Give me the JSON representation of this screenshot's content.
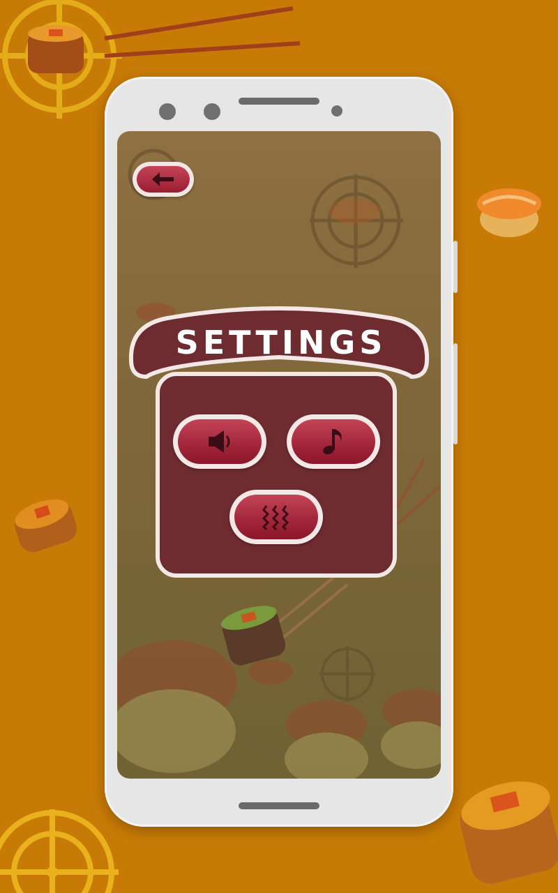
{
  "screen": {
    "title": "SETTINGS"
  },
  "controls": {
    "back": {
      "icon": "arrow-left-icon"
    },
    "sound": {
      "icon": "speaker-icon"
    },
    "music": {
      "icon": "music-note-icon"
    },
    "vibration": {
      "icon": "vibration-icon"
    }
  },
  "colors": {
    "background": "#c77a06",
    "panel": "#6e2c31",
    "button": "#b0314a",
    "panel_border": "#f3e8e6"
  }
}
